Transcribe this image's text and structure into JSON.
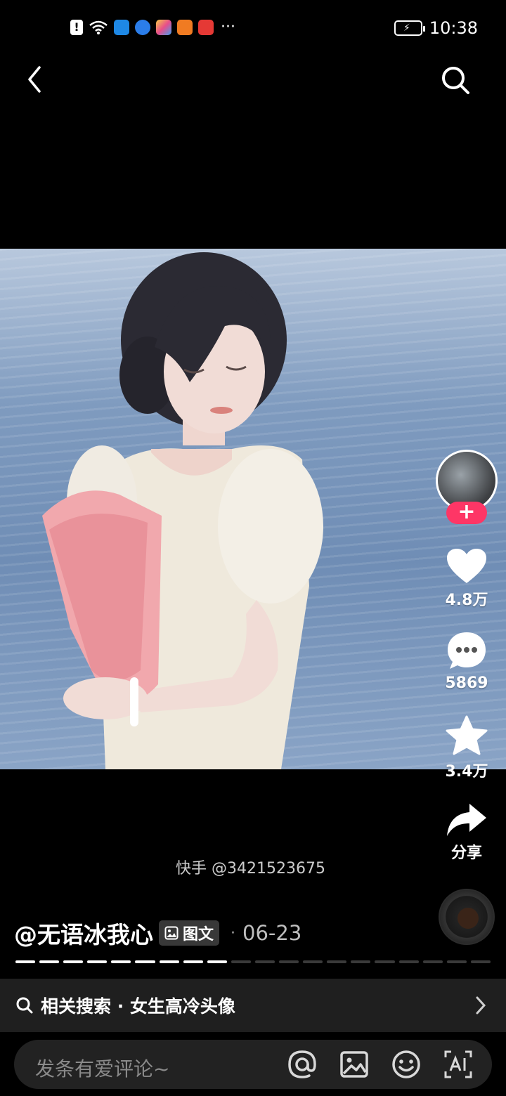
{
  "status_bar": {
    "time": "10:38",
    "alert_glyph": "!",
    "more_glyph": "···",
    "app_icons": [
      {
        "name": "wifi-icon",
        "color": "#ffffff"
      },
      {
        "name": "weather-app-icon",
        "color": "#1e88e5"
      },
      {
        "name": "browser-app-icon",
        "color": "#2b7de9"
      },
      {
        "name": "app-icon-colorful",
        "color": "#e84e8a"
      },
      {
        "name": "video-app-icon",
        "color": "#f07b22"
      },
      {
        "name": "red-app-icon",
        "color": "#e53935"
      }
    ]
  },
  "nav": {
    "back_icon": "chevron-left-icon",
    "search_icon": "search-icon"
  },
  "actions": {
    "follow_label": "+",
    "likes": "4.8万",
    "comments": "5869",
    "favorites": "3.4万",
    "share": "分享"
  },
  "watermark": "快手 @3421523675",
  "post": {
    "author": "@无语冰我心",
    "type_label": "图文",
    "separator": "·",
    "date": "06-23"
  },
  "progress": {
    "total_segments": 20,
    "completed_segments": 9
  },
  "related_search": {
    "text": "相关搜索 · 女生高冷头像"
  },
  "comment_bar": {
    "placeholder": "发条有爱评论~",
    "icons": [
      "at-icon",
      "image-icon",
      "emoji-icon",
      "ai-icon"
    ]
  },
  "colors": {
    "accent_pink": "#fe3666",
    "background": "#000000"
  }
}
